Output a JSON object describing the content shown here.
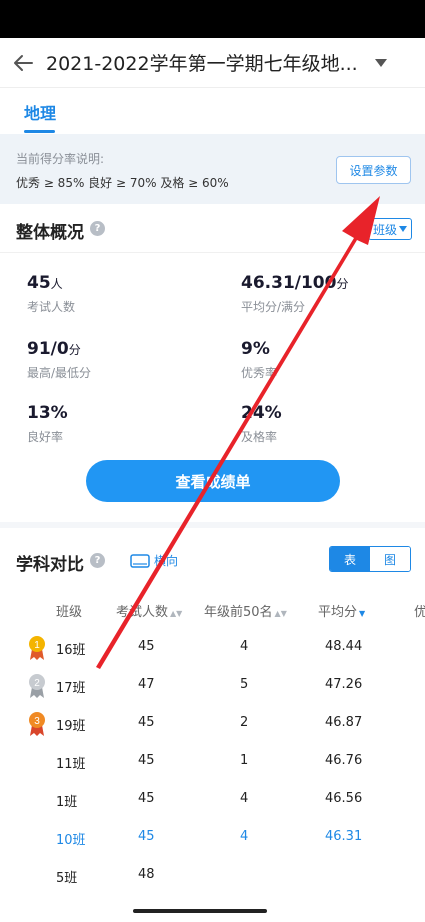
{
  "header": {
    "title": "2021-2022学年第一学期七年级地..."
  },
  "tabs": [
    {
      "label": "地理"
    }
  ],
  "rates": {
    "label": "当前得分率说明:",
    "text": "优秀 ≥ 85% 良好 ≥ 70% 及格 ≥ 60%",
    "button": "设置参数"
  },
  "overview": {
    "title": "整体概况",
    "class_selector": "班级",
    "stats": [
      {
        "value": "45",
        "unit": "人",
        "label": "考试人数"
      },
      {
        "value": "46.31/100",
        "unit": "分",
        "label": "平均分/满分"
      },
      {
        "value": "91/0",
        "unit": "分",
        "label": "最高/最低分"
      },
      {
        "value": "9%",
        "unit": "",
        "label": "优秀率"
      },
      {
        "value": "13%",
        "unit": "",
        "label": "良好率"
      },
      {
        "value": "24%",
        "unit": "",
        "label": "及格率"
      }
    ],
    "score_button": "查看成绩单"
  },
  "compare": {
    "title": "学科对比",
    "landscape": "横向",
    "toggle": {
      "table": "表",
      "chart": "图"
    },
    "headers": [
      "班级",
      "考试人数",
      "年级前50名",
      "平均分",
      "优"
    ],
    "rows": [
      {
        "class": "16班",
        "count": "45",
        "top50": "4",
        "avg": "48.44",
        "medal": "gold",
        "rank": "1"
      },
      {
        "class": "17班",
        "count": "47",
        "top50": "5",
        "avg": "47.26",
        "medal": "silver",
        "rank": "2"
      },
      {
        "class": "19班",
        "count": "45",
        "top50": "2",
        "avg": "46.87",
        "medal": "bronze",
        "rank": "3"
      },
      {
        "class": "11班",
        "count": "45",
        "top50": "1",
        "avg": "46.76"
      },
      {
        "class": "1班",
        "count": "45",
        "top50": "4",
        "avg": "46.56"
      },
      {
        "class": "10班",
        "count": "45",
        "top50": "4",
        "avg": "46.31",
        "highlight": true
      },
      {
        "class": "5班",
        "count": "48",
        "top50": "",
        "avg": ""
      }
    ]
  },
  "colors": {
    "accent": "#1e88e5",
    "annotation": "#e8232a"
  }
}
